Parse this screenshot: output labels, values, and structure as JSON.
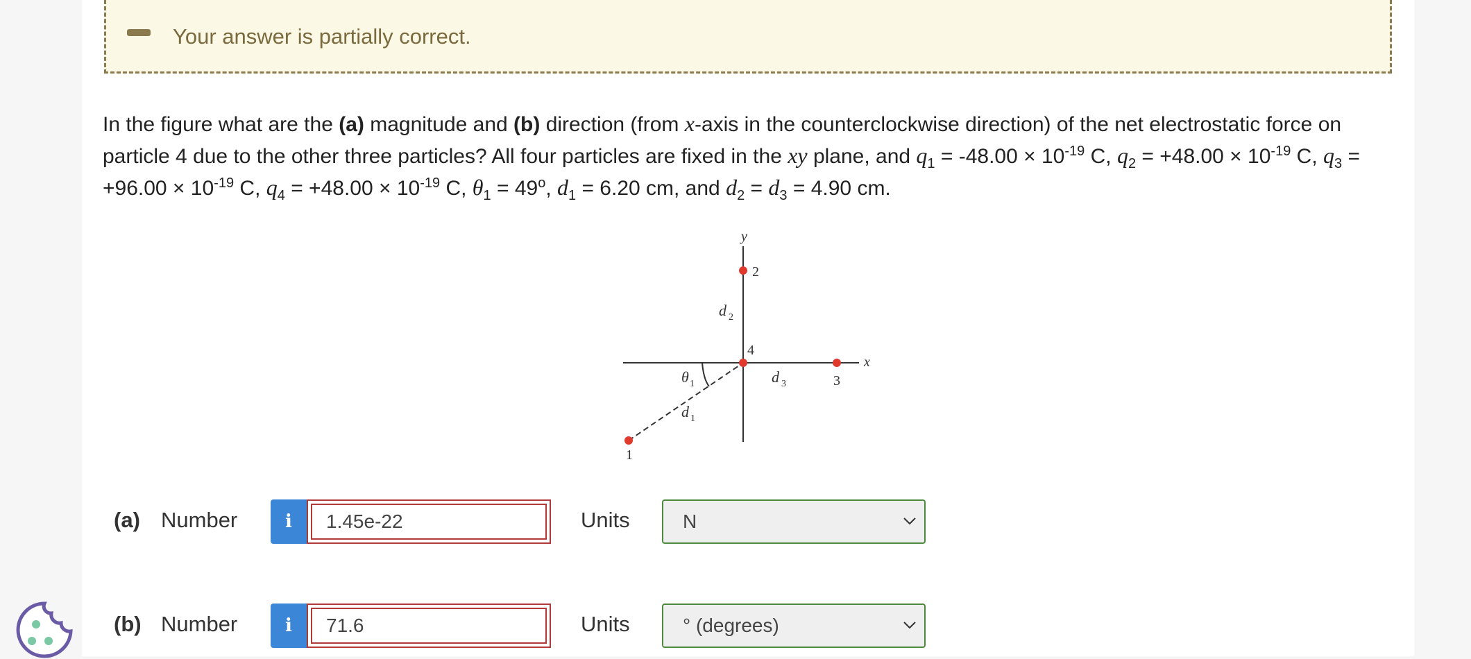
{
  "banner": {
    "message": "Your answer is partially correct."
  },
  "question": {
    "t1": "In the figure what are the ",
    "a": "(a)",
    "t2": " magnitude and ",
    "b": "(b)",
    "t3": " direction (from ",
    "xvar": "x",
    "t4": "-axis in the counterclockwise direction) of the net electrostatic force on particle 4 due to the other three particles? All four particles are fixed in the ",
    "xy": "xy",
    "t5": " plane, and ",
    "q": "q",
    "s1": "1",
    "v1": " = -48.00 × 10",
    "e1": "-19",
    "c1": " C, ",
    "s2": "2",
    "v2": " = +48.00 × 10",
    "e2": "-19",
    "c2": " C, ",
    "s3": "3",
    "v3": " = +96.00 × 10",
    "e3": "-19",
    "c3": " C, ",
    "s4": "4",
    "v4": " = +48.00 × 10",
    "e4": "-19",
    "c4": " C, ",
    "theta": "θ",
    "ts1": "1",
    "tv": " = 49",
    "deg": "o",
    "sep": ", ",
    "d": "d",
    "ds1": "1",
    "dv1": " = 6.20 cm, and ",
    "ds2": "2",
    "eq": " = ",
    "ds3": "3",
    "dv3": " = 4.90 cm."
  },
  "figure": {
    "y_axis": "y",
    "x_axis": "x",
    "p1": "1",
    "p2": "2",
    "p3": "3",
    "p4": "4",
    "d1": "d",
    "d1s": "1",
    "d2": "d",
    "d2s": "2",
    "d3": "d",
    "d3s": "3",
    "theta": "θ",
    "theta_s": "1",
    "particle_color": "#e03a2e"
  },
  "answers": [
    {
      "part": "(a)",
      "label": "Number",
      "info_icon": "i",
      "value": "1.45e-22",
      "units_label": "Units",
      "units_value": "N"
    },
    {
      "part": "(b)",
      "label": "Number",
      "info_icon": "i",
      "value": "71.6",
      "units_label": "Units",
      "units_value": "° (degrees)"
    }
  ],
  "colors": {
    "banner_bg": "#fcf8e6",
    "banner_border": "#8a7a4e",
    "info_blue": "#3b86d6",
    "incorrect_red": "#b03a3a",
    "units_green": "#4e8a3e"
  }
}
